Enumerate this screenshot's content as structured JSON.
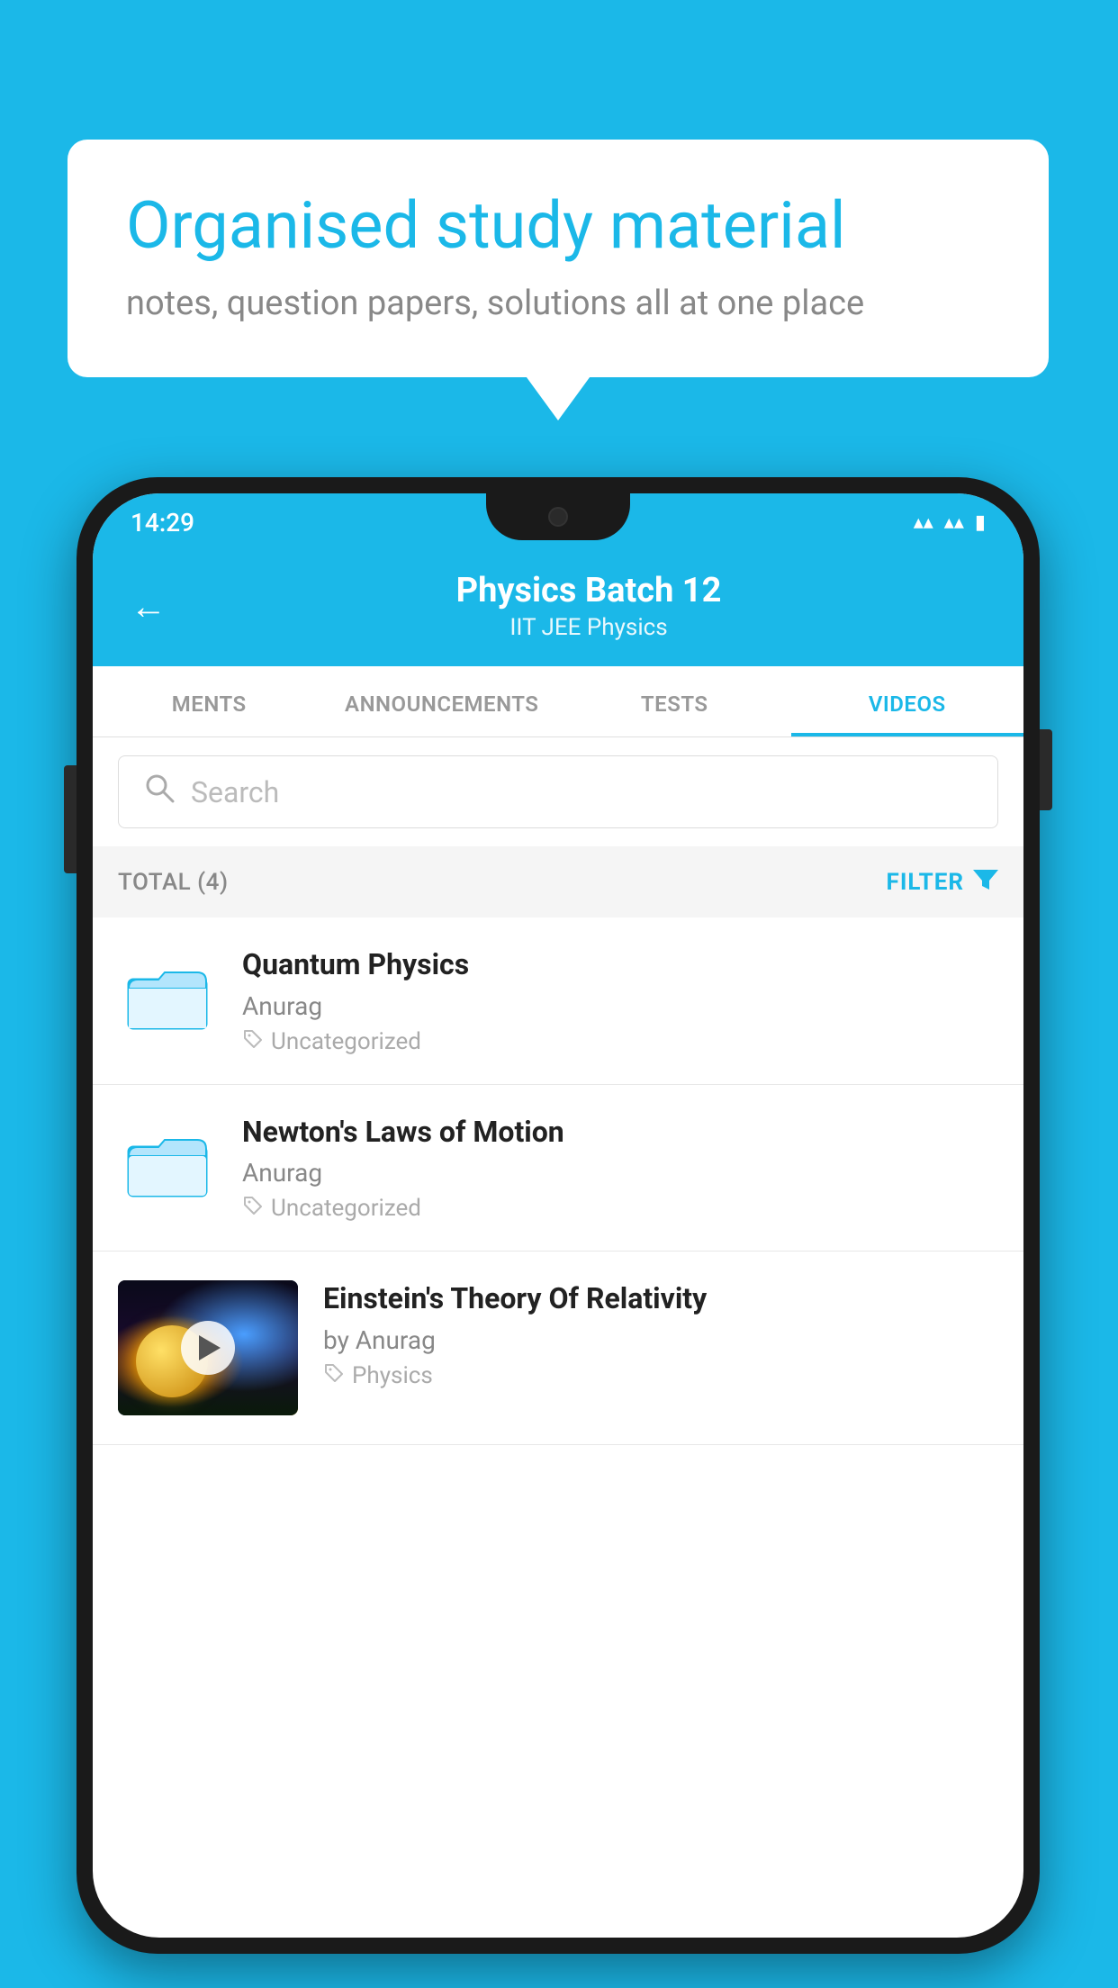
{
  "background_color": "#1BB8E8",
  "speech_bubble": {
    "title": "Organised study material",
    "subtitle": "notes, question papers, solutions all at one place"
  },
  "status_bar": {
    "time": "14:29",
    "wifi": "▾",
    "signal": "▾",
    "battery": "▮"
  },
  "header": {
    "back_label": "←",
    "title": "Physics Batch 12",
    "subtitle": "IIT JEE   Physics"
  },
  "tabs": [
    {
      "label": "MENTS",
      "active": false
    },
    {
      "label": "ANNOUNCEMENTS",
      "active": false
    },
    {
      "label": "TESTS",
      "active": false
    },
    {
      "label": "VIDEOS",
      "active": true
    }
  ],
  "search": {
    "placeholder": "Search"
  },
  "filter_bar": {
    "total_label": "TOTAL (4)",
    "filter_label": "FILTER"
  },
  "videos": [
    {
      "id": "quantum-physics",
      "title": "Quantum Physics",
      "author": "Anurag",
      "tag": "Uncategorized",
      "has_thumbnail": false
    },
    {
      "id": "newtons-laws",
      "title": "Newton's Laws of Motion",
      "author": "Anurag",
      "tag": "Uncategorized",
      "has_thumbnail": false
    },
    {
      "id": "einsteins-theory",
      "title": "Einstein's Theory Of Relativity",
      "author": "by Anurag",
      "tag": "Physics",
      "has_thumbnail": true
    }
  ]
}
